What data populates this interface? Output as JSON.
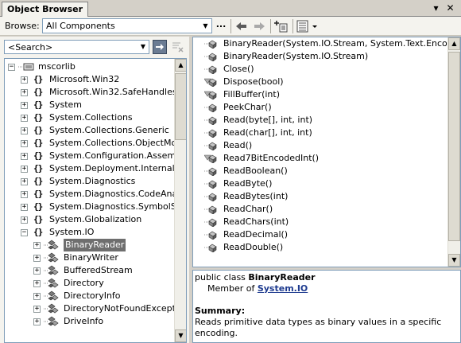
{
  "window": {
    "tab_title": "Object Browser",
    "menu_glyph": "▾",
    "close_glyph": "✕"
  },
  "browse_bar": {
    "label": "Browse:",
    "selected": "All Components",
    "ellipsis": "..."
  },
  "search": {
    "value": "<Search>"
  },
  "tree": {
    "items": [
      {
        "level": 0,
        "expander": "−",
        "icon": "assembly-icon",
        "label": "mscorlib"
      },
      {
        "level": 1,
        "expander": "+",
        "icon": "namespace-icon",
        "label": "Microsoft.Win32"
      },
      {
        "level": 1,
        "expander": "+",
        "icon": "namespace-icon",
        "label": "Microsoft.Win32.SafeHandles"
      },
      {
        "level": 1,
        "expander": "+",
        "icon": "namespace-icon",
        "label": "System"
      },
      {
        "level": 1,
        "expander": "+",
        "icon": "namespace-icon",
        "label": "System.Collections"
      },
      {
        "level": 1,
        "expander": "+",
        "icon": "namespace-icon",
        "label": "System.Collections.Generic"
      },
      {
        "level": 1,
        "expander": "+",
        "icon": "namespace-icon",
        "label": "System.Collections.ObjectModel"
      },
      {
        "level": 1,
        "expander": "+",
        "icon": "namespace-icon",
        "label": "System.Configuration.Assemblies"
      },
      {
        "level": 1,
        "expander": "+",
        "icon": "namespace-icon",
        "label": "System.Deployment.Internal"
      },
      {
        "level": 1,
        "expander": "+",
        "icon": "namespace-icon",
        "label": "System.Diagnostics"
      },
      {
        "level": 1,
        "expander": "+",
        "icon": "namespace-icon",
        "label": "System.Diagnostics.CodeAnalysis"
      },
      {
        "level": 1,
        "expander": "+",
        "icon": "namespace-icon",
        "label": "System.Diagnostics.SymbolStore"
      },
      {
        "level": 1,
        "expander": "+",
        "icon": "namespace-icon",
        "label": "System.Globalization"
      },
      {
        "level": 1,
        "expander": "−",
        "icon": "namespace-icon",
        "label": "System.IO"
      },
      {
        "level": 2,
        "expander": "+",
        "icon": "class-icon",
        "label": "BinaryReader",
        "selected": true
      },
      {
        "level": 2,
        "expander": "+",
        "icon": "class-icon",
        "label": "BinaryWriter"
      },
      {
        "level": 2,
        "expander": "+",
        "icon": "class-icon",
        "label": "BufferedStream"
      },
      {
        "level": 2,
        "expander": "+",
        "icon": "class-icon",
        "label": "Directory"
      },
      {
        "level": 2,
        "expander": "+",
        "icon": "class-icon",
        "label": "DirectoryInfo"
      },
      {
        "level": 2,
        "expander": "+",
        "icon": "class-icon",
        "label": "DirectoryNotFoundException"
      },
      {
        "level": 2,
        "expander": "+",
        "icon": "class-icon",
        "label": "DriveInfo"
      }
    ]
  },
  "members": {
    "items": [
      {
        "icon": "method-icon",
        "label": "BinaryReader(System.IO.Stream, System.Text.Encoding)"
      },
      {
        "icon": "method-icon",
        "label": "BinaryReader(System.IO.Stream)"
      },
      {
        "icon": "method-icon",
        "label": "Close()"
      },
      {
        "icon": "protected-method-icon",
        "label": "Dispose(bool)"
      },
      {
        "icon": "protected-method-icon",
        "label": "FillBuffer(int)"
      },
      {
        "icon": "method-icon",
        "label": "PeekChar()"
      },
      {
        "icon": "method-icon",
        "label": "Read(byte[], int, int)"
      },
      {
        "icon": "method-icon",
        "label": "Read(char[], int, int)"
      },
      {
        "icon": "method-icon",
        "label": "Read()"
      },
      {
        "icon": "protected-method-icon",
        "label": "Read7BitEncodedInt()"
      },
      {
        "icon": "method-icon",
        "label": "ReadBoolean()"
      },
      {
        "icon": "method-icon",
        "label": "ReadByte()"
      },
      {
        "icon": "method-icon",
        "label": "ReadBytes(int)"
      },
      {
        "icon": "method-icon",
        "label": "ReadChar()"
      },
      {
        "icon": "method-icon",
        "label": "ReadChars(int)"
      },
      {
        "icon": "method-icon",
        "label": "ReadDecimal()"
      },
      {
        "icon": "method-icon",
        "label": "ReadDouble()"
      }
    ]
  },
  "description": {
    "declaration_prefix": "public class ",
    "declaration_name": "BinaryReader",
    "member_of_prefix": "Member of ",
    "member_of_link": "System.IO",
    "summary_heading": "Summary:",
    "summary_text": "Reads primitive data types as binary values in a specific encoding."
  },
  "colors": {
    "selection": "#6e6e6e",
    "link": "#1e3b8f",
    "panel": "#f4f3ee",
    "border": "#7f9db9"
  }
}
